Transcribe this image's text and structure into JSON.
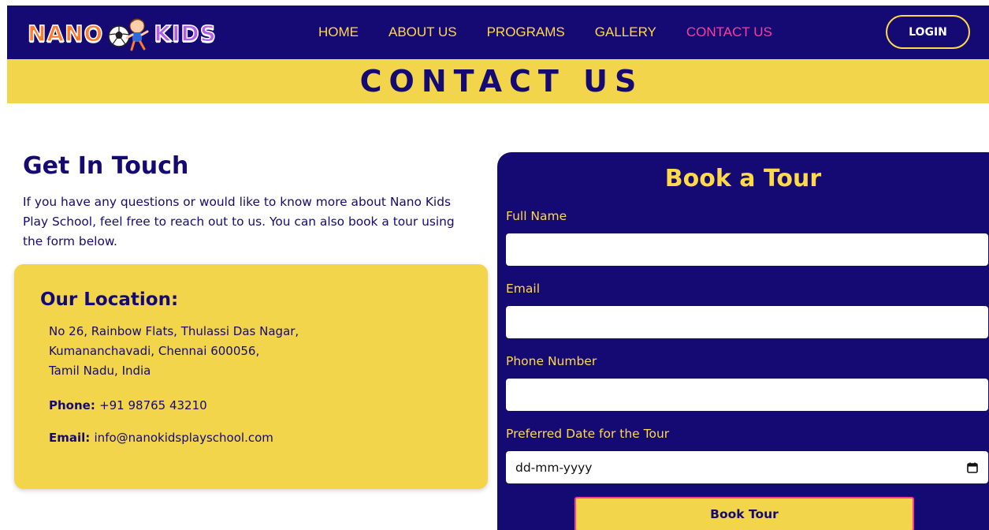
{
  "brand": {
    "logo_left": "NANO",
    "logo_right": "KIDS",
    "colors": {
      "navy": "#150a73",
      "yellow": "#f2d54a",
      "gold_text": "#ffd94a",
      "pink": "#ff3b9d"
    }
  },
  "nav": {
    "items": [
      {
        "label": "HOME",
        "active": false
      },
      {
        "label": "ABOUT US",
        "active": false
      },
      {
        "label": "PROGRAMS",
        "active": false
      },
      {
        "label": "GALLERY",
        "active": false
      },
      {
        "label": "CONTACT US",
        "active": true
      }
    ],
    "login_label": "LOGIN"
  },
  "banner": {
    "title": "CONTACT US"
  },
  "get_in_touch": {
    "title": "Get In Touch",
    "text": "If you have any questions or would like to know more about Nano Kids Play School, feel free to reach out to us. You can also book a tour using the form below."
  },
  "location": {
    "title": "Our Location:",
    "address_lines": [
      "No 26, Rainbow Flats, Thulassi Das Nagar,",
      "Kumananchavadi, Chennai 600056,",
      "Tamil Nadu, India"
    ],
    "phone_label": "Phone:",
    "phone_value": "+91 98765 43210",
    "email_label": "Email:",
    "email_value": "info@nanokidsplayschool.com"
  },
  "tour_form": {
    "title": "Book a Tour",
    "full_name_label": "Full Name",
    "full_name_value": "",
    "email_label": "Email",
    "email_value": "",
    "phone_label": "Phone Number",
    "phone_value": "",
    "date_label": "Preferred Date for the Tour",
    "date_placeholder": "dd-mm-yyyy",
    "submit_label": "Book Tour"
  },
  "icons": {
    "logo_mascot": "soccer-boy-mascot-icon",
    "date_picker": "calendar-icon"
  }
}
